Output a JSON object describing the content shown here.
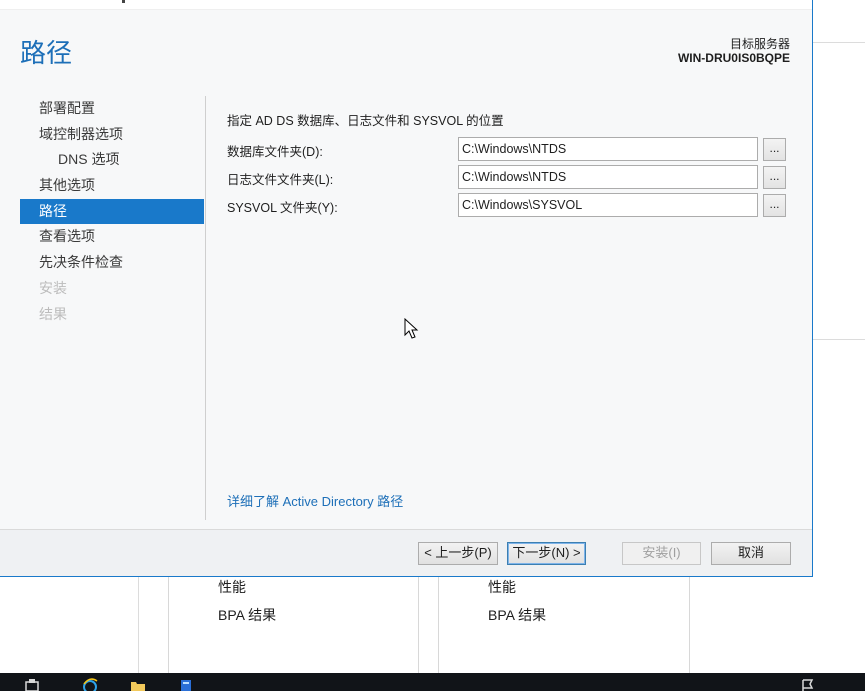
{
  "background": {
    "tiles": [
      {
        "performance_label": "性能",
        "bpa_label": "BPA 结果"
      },
      {
        "performance_label": "性能",
        "bpa_label": "BPA 结果"
      }
    ]
  },
  "wizard": {
    "title": "路径",
    "target_server_label": "目标服务器",
    "target_server_name": "WIN-DRU0IS0BQPE",
    "nav": [
      {
        "label": "部署配置",
        "state": "normal"
      },
      {
        "label": "域控制器选项",
        "state": "normal"
      },
      {
        "label": "DNS 选项",
        "state": "sub"
      },
      {
        "label": "其他选项",
        "state": "normal"
      },
      {
        "label": "路径",
        "state": "active"
      },
      {
        "label": "查看选项",
        "state": "normal"
      },
      {
        "label": "先决条件检查",
        "state": "normal"
      },
      {
        "label": "安装",
        "state": "disabled"
      },
      {
        "label": "结果",
        "state": "disabled"
      }
    ],
    "instruction": "指定 AD DS 数据库、日志文件和 SYSVOL 的位置",
    "fields": [
      {
        "label": "数据库文件夹(D):",
        "value": "C:\\Windows\\NTDS",
        "browse": "..."
      },
      {
        "label": "日志文件文件夹(L):",
        "value": "C:\\Windows\\NTDS",
        "browse": "..."
      },
      {
        "label": "SYSVOL 文件夹(Y):",
        "value": "C:\\Windows\\SYSVOL",
        "browse": "..."
      }
    ],
    "learn_more_link": "详细了解 Active Directory 路径",
    "buttons": {
      "previous": "< 上一步(P)",
      "next": "下一步(N) >",
      "install": "安装(I)",
      "cancel": "取消"
    }
  },
  "colors": {
    "accent": "#1979ca",
    "title": "#1d6fb8",
    "taskbar": "#111418"
  },
  "taskbar": {
    "icons": [
      "server-manager-icon",
      "ie-icon",
      "folder-icon",
      "powershell-icon"
    ]
  }
}
